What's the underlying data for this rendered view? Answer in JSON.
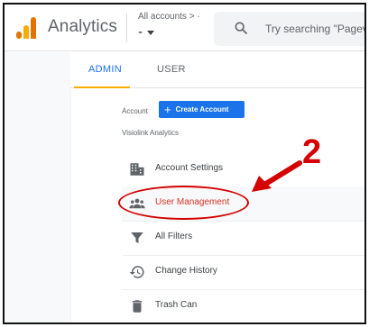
{
  "topbar": {
    "app_title": "Analytics",
    "account_breadcrumb": "All accounts > ·",
    "account_selected": "-",
    "search_placeholder": "Try searching \"Pagev"
  },
  "tabs": [
    {
      "label": "ADMIN",
      "active": true
    },
    {
      "label": "USER",
      "active": false
    }
  ],
  "account": {
    "label": "Account",
    "create_button": "Create Account",
    "name": "Visiolink Analytics"
  },
  "menu": [
    {
      "label": "Account Settings",
      "icon": "building-icon"
    },
    {
      "label": "User Management",
      "icon": "people-icon",
      "highlighted": true
    },
    {
      "label": "All Filters",
      "icon": "filter-icon"
    },
    {
      "label": "Change History",
      "icon": "history-icon"
    },
    {
      "label": "Trash Can",
      "icon": "trash-icon"
    }
  ],
  "annotation": {
    "number": "2",
    "color": "#d50000"
  },
  "colors": {
    "accent_blue": "#1a73e8",
    "tab_underline": "#f9ab00",
    "logo_orange": "#e37400",
    "highlight_text": "#d93025"
  }
}
